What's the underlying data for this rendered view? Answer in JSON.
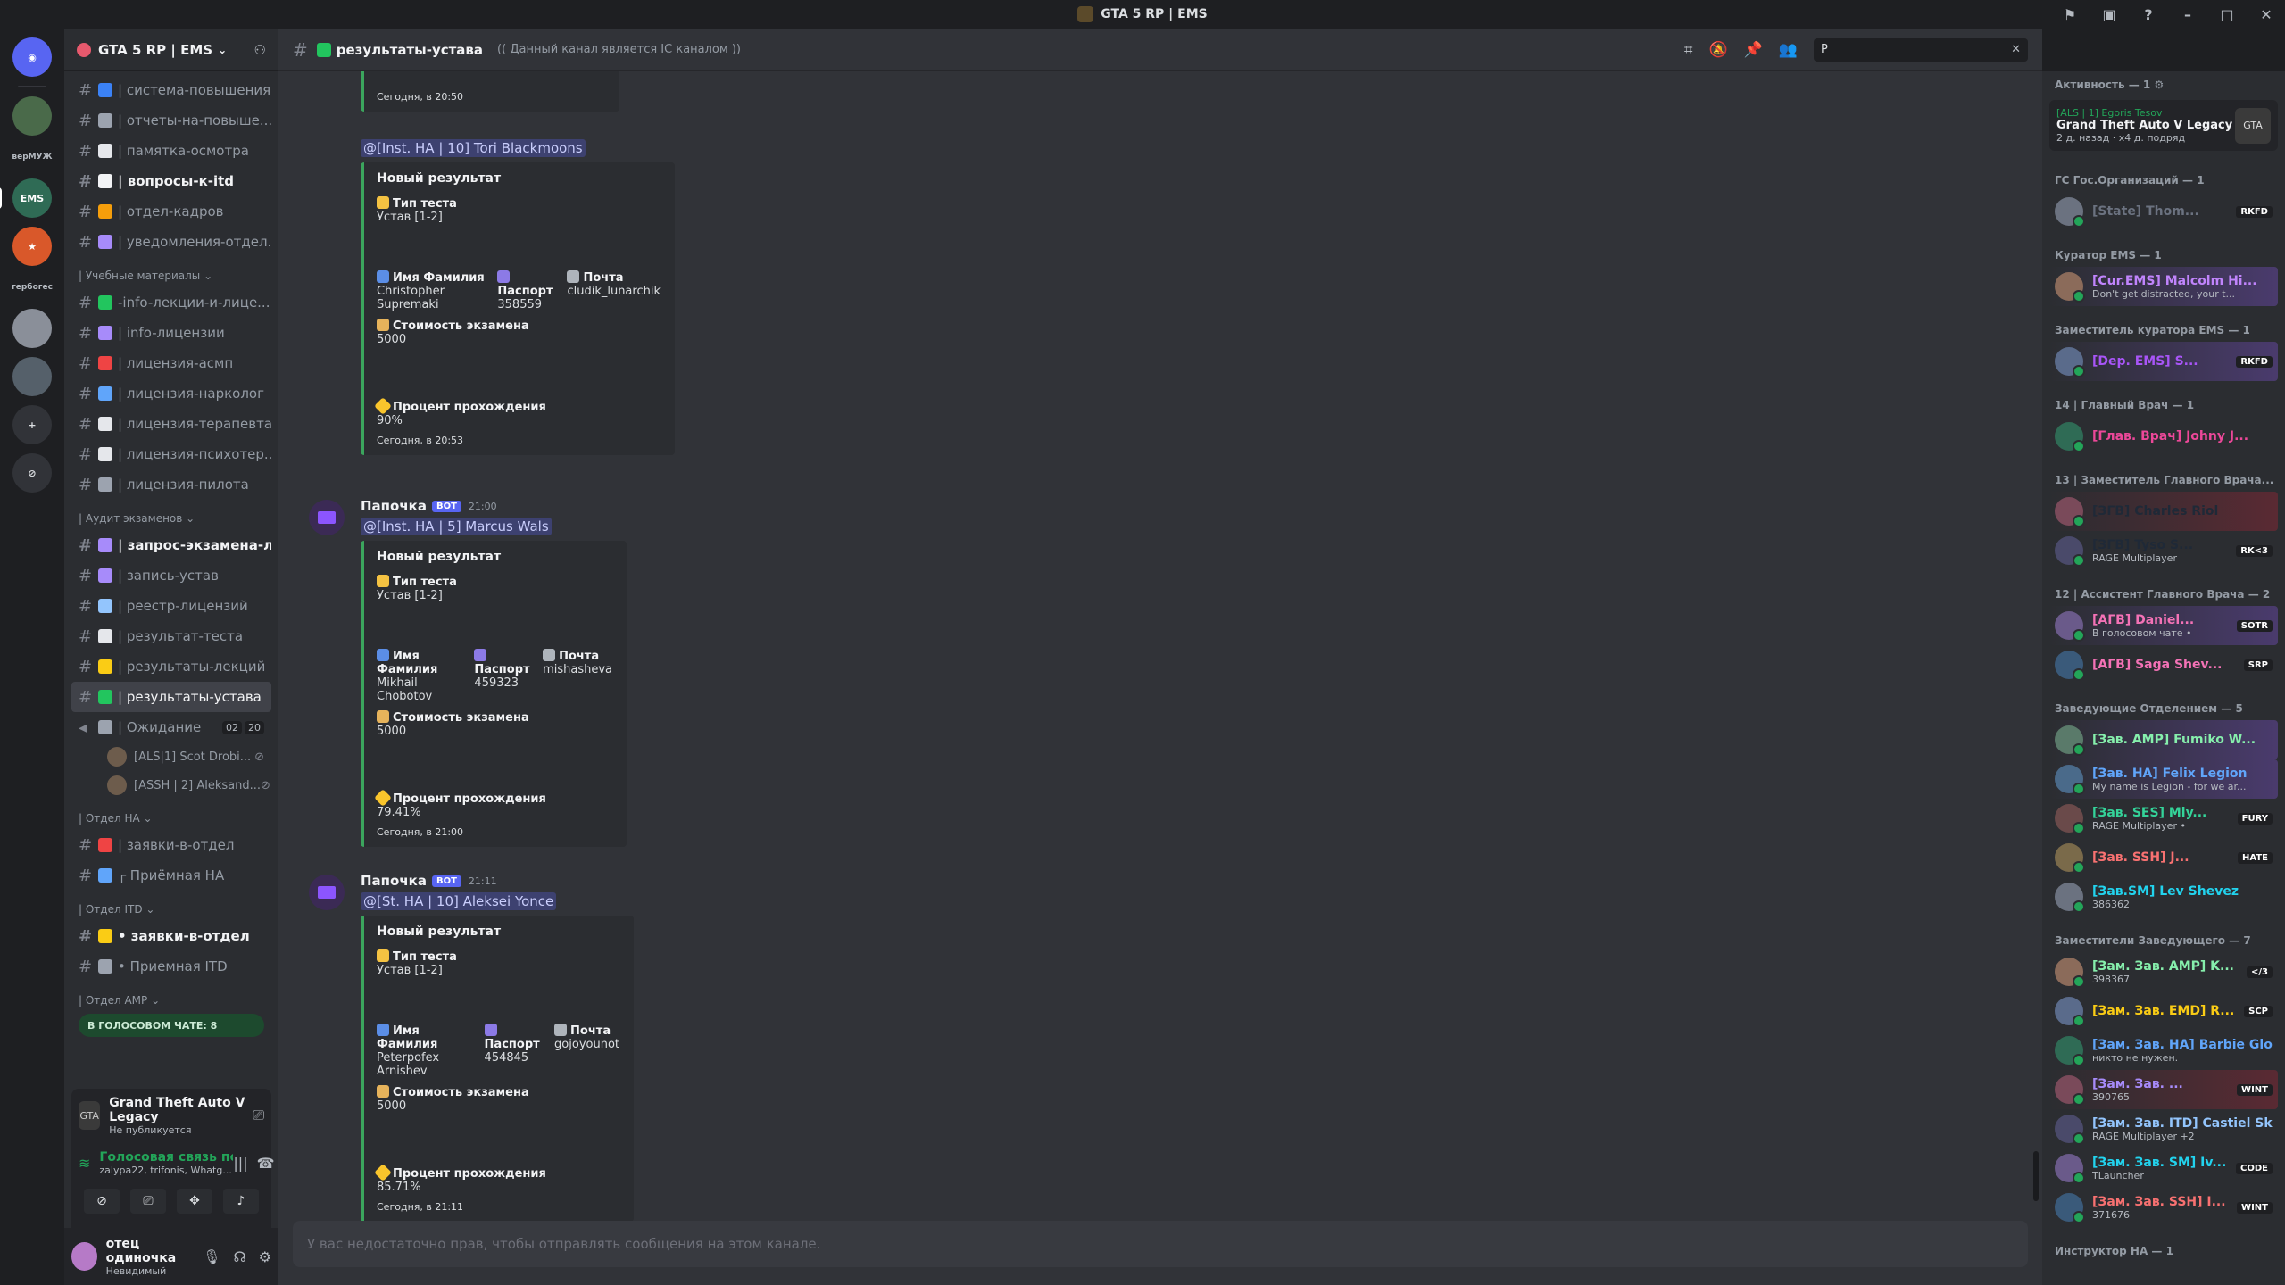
{
  "window": {
    "title": "GTA 5 RP | EMS"
  },
  "rail": {
    "labels": [
      "верМУЖ",
      "EMS",
      "гербогес"
    ]
  },
  "sidebar": {
    "guild_name": "GTA 5 RP | EMS",
    "channels_top": [
      {
        "name": "| система-повышения",
        "color": "#3b82f6"
      },
      {
        "name": "| отчеты-на-повыше...",
        "color": "#9ca3af"
      },
      {
        "name": "| памятка-осмотра",
        "color": "#e5e7eb"
      },
      {
        "name": "| вопросы-к-itd",
        "color": "#f2f3f5",
        "unread": true
      },
      {
        "name": "| отдел-кадров",
        "color": "#f59e0b"
      },
      {
        "name": "| уведомления-отдел...",
        "color": "#a78bfa"
      }
    ],
    "cat1": "| Учебные материалы",
    "channels_edu": [
      {
        "name": "-info-лекции-и-лице...",
        "color": "#22c55e"
      },
      {
        "name": "| info-лицензии",
        "color": "#a78bfa"
      },
      {
        "name": "| лицензия-асмп",
        "color": "#ef4444"
      },
      {
        "name": "| лицензия-нарколог",
        "color": "#60a5fa"
      },
      {
        "name": "| лицензия-терапевта",
        "color": "#e5e7eb"
      },
      {
        "name": "| лицензия-психотер...",
        "color": "#e5e7eb"
      },
      {
        "name": "| лицензия-пилота",
        "color": "#9ca3af"
      }
    ],
    "cat2": "| Аудит экзаменов",
    "channels_audit": [
      {
        "name": "| запрос-экзамена-л...",
        "color": "#a78bfa",
        "unread": true
      },
      {
        "name": "| запись-устав",
        "color": "#a78bfa"
      },
      {
        "name": "| реестр-лицензий",
        "color": "#93c5fd"
      },
      {
        "name": "| результат-теста",
        "color": "#e5e7eb"
      },
      {
        "name": "| результаты-лекций",
        "color": "#facc15"
      },
      {
        "name": "| результаты-устава",
        "color": "#22c55e",
        "active": true
      }
    ],
    "voice_waiting": {
      "name": "| Ожидание",
      "count_a": "02",
      "count_b": "20"
    },
    "voice_users": [
      "[ALS|1] Scot Drobi...",
      "[ASSH | 2] Aleksand..."
    ],
    "cat3": "| Отдел HA",
    "channels_ha": [
      {
        "name": "| заявки-в-отдел",
        "color": "#ef4444"
      },
      {
        "name": "┌ Приёмная HA",
        "color": "#60a5fa"
      }
    ],
    "cat4": "| Отдел ITD",
    "channels_itd": [
      {
        "name": "• заявки-в-отдел",
        "color": "#facc15",
        "unread": true
      },
      {
        "name": "• Приемная ITD",
        "color": "#9ca3af"
      }
    ],
    "cat5": "| Отдел AMP",
    "voice_banner": "В ГОЛОСОВОМ ЧАТЕ: 8",
    "activity": {
      "title": "Grand Theft Auto V Legacy",
      "subtitle": "Не публикуется",
      "icon": "GTA"
    },
    "voice": {
      "title": "Голосовая связь подкл",
      "subtitle": "zalypa22, trifonis, Whatg..."
    },
    "user": {
      "name": "отец одиночка",
      "status": "Невидимый"
    }
  },
  "chat": {
    "channel_name": "результаты-устава",
    "topic": "(( Данный канал является IC каналом ))",
    "search_value": "P",
    "top_footer": "Сегодня, в 20:50",
    "messages": [
      {
        "author": "",
        "bot": "",
        "time": "",
        "mention": "@[Inst. HA | 10] Tori Blackmoons",
        "embed": {
          "title": "Новый результат",
          "f_type_label": "Тип теста",
          "f_type_val": "Устав [1-2]",
          "f_name_label": "Имя Фамилия",
          "f_name_val": "Christopher Supremaki",
          "f_pass_label": "Паспорт",
          "f_pass_val": "358559",
          "f_mail_label": "Почта",
          "f_mail_val": "cludik_lunarchik",
          "f_cost_label": "Стоимость экзамена",
          "f_cost_val": "5000",
          "f_pct_label": "Процент прохождения",
          "f_pct_val": "90%",
          "footer": "Сегодня, в 20:53"
        }
      },
      {
        "author": "Папочка",
        "bot": "BOT",
        "time": "21:00",
        "mention": "@[Inst. HA | 5] Marcus Wals",
        "embed": {
          "title": "Новый результат",
          "f_type_label": "Тип теста",
          "f_type_val": "Устав [1-2]",
          "f_name_label": "Имя Фамилия",
          "f_name_val": "Mikhail Chobotov",
          "f_pass_label": "Паспорт",
          "f_pass_val": "459323",
          "f_mail_label": "Почта",
          "f_mail_val": "mishasheva",
          "f_cost_label": "Стоимость экзамена",
          "f_cost_val": "5000",
          "f_pct_label": "Процент прохождения",
          "f_pct_val": "79.41%",
          "footer": "Сегодня, в 21:00"
        }
      },
      {
        "author": "Папочка",
        "bot": "BOT",
        "time": "21:11",
        "mention": "@[St. HA | 10] Aleksei Yonce",
        "embed": {
          "title": "Новый результат",
          "f_type_label": "Тип теста",
          "f_type_val": "Устав [1-2]",
          "f_name_label": "Имя Фамилия",
          "f_name_val": "Peterpofex Arnishev",
          "f_pass_label": "Паспорт",
          "f_pass_val": "454845",
          "f_mail_label": "Почта",
          "f_mail_val": "gojoyounot",
          "f_cost_label": "Стоимость экзамена",
          "f_cost_val": "5000",
          "f_pct_label": "Процент прохождения",
          "f_pct_val": "85.71%",
          "footer": "Сегодня, в 21:11"
        }
      }
    ],
    "composer_placeholder": "У вас недостаточно прав, чтобы отправлять сообщения на этом канале."
  },
  "members": {
    "activity_header": "Активность — 1",
    "activity_card": {
      "line1": "[ALS | 1] Egoris Tesov",
      "line2": "Grand Theft Auto V Legacy",
      "line3": "2 д. назад · x4 д. подряд",
      "icon": "GTA"
    },
    "groups": [
      {
        "title": "ГС Гос.Организаций — 1",
        "members": [
          {
            "name": "[State] Thom...",
            "color": "#6b7280",
            "tag": "RKFD",
            "sub": "",
            "style": ""
          }
        ]
      },
      {
        "title": "Куратор EMS — 1",
        "members": [
          {
            "name": "[Cur.EMS] Malcolm Hi...",
            "color": "#c084fc",
            "tag": "",
            "sub": "Don't get distracted, your t...",
            "style": "boosted"
          }
        ]
      },
      {
        "title": "Заместитель куратора EMS — 1",
        "members": [
          {
            "name": "[Dep. EMS] S...",
            "color": "#a855f7",
            "tag": "RKFD",
            "sub": "",
            "style": "boosted"
          }
        ]
      },
      {
        "title": "14 | Главный Врач — 1",
        "members": [
          {
            "name": "[Глав. Врач] Johny J...",
            "color": "#ec4899",
            "tag": "",
            "sub": "",
            "style": ""
          }
        ]
      },
      {
        "title": "13 | Заместитель Главного Врача...",
        "members": [
          {
            "name": "[ЗГВ] Charles Riol",
            "color": "#1f2937",
            "tag": "",
            "sub": "",
            "style": "red"
          },
          {
            "name": "[ЗГВ] Tyso S...",
            "color": "#1f2937",
            "tag": "RK<3",
            "sub": "RAGE Multiplayer",
            "style": ""
          }
        ]
      },
      {
        "title": "12 | Ассистент Главного Врача — 2",
        "members": [
          {
            "name": "[АГВ] Daniel...",
            "color": "#f472b6",
            "tag": "SOTR",
            "sub": "В голосовом чате •",
            "style": "boosted"
          },
          {
            "name": "[АГВ] Saga Shev...",
            "color": "#f472b6",
            "tag": "SRP",
            "sub": "",
            "style": ""
          }
        ]
      },
      {
        "title": "Заведующие Отделением — 5",
        "members": [
          {
            "name": "[Зав. AMP] Fumiko W...",
            "color": "#86efac",
            "tag": "",
            "sub": "",
            "style": "boosted"
          },
          {
            "name": "[Зав. HA] Felix Legion",
            "color": "#60a5fa",
            "tag": "",
            "sub": "My name is Legion - for we ar...",
            "style": "boosted"
          },
          {
            "name": "[Зав. SES] Mly...",
            "color": "#34d399",
            "tag": "FURY",
            "sub": "RAGE Multiplayer •",
            "style": ""
          },
          {
            "name": "[Зав. SSH] J...",
            "color": "#f87171",
            "tag": "HATE",
            "sub": "",
            "style": ""
          },
          {
            "name": "[Зав.SM] Lev Shevez",
            "color": "#22d3ee",
            "tag": "",
            "sub": "386362",
            "style": ""
          }
        ]
      },
      {
        "title": "Заместители Заведующего — 7",
        "members": [
          {
            "name": "[Зам. Зав. AMP] K...",
            "color": "#86efac",
            "tag": "</3",
            "sub": "398367",
            "style": ""
          },
          {
            "name": "[Зам. Зав. EMD] R...",
            "color": "#facc15",
            "tag": "SCP",
            "sub": "",
            "style": ""
          },
          {
            "name": "[Зам. Зав. HA] Barbie Glo...",
            "color": "#60a5fa",
            "tag": "",
            "sub": "никто не нужен.",
            "style": ""
          },
          {
            "name": "[Зам. Зав. ...",
            "color": "#a78bfa",
            "tag": "WINT",
            "sub": "390765",
            "style": "red"
          },
          {
            "name": "[Зам. Зав. ITD] Castiel Sk...",
            "color": "#93c5fd",
            "tag": "",
            "sub": "RAGE Multiplayer +2",
            "style": ""
          },
          {
            "name": "[Зам. Зав. SM] Iv...",
            "color": "#22d3ee",
            "tag": "CODE",
            "sub": "TLauncher",
            "style": ""
          },
          {
            "name": "[Зам. Зав. SSH] I...",
            "color": "#f87171",
            "tag": "WINT",
            "sub": "371676",
            "style": ""
          }
        ]
      },
      {
        "title": "Инструктор HA — 1",
        "members": []
      }
    ]
  }
}
